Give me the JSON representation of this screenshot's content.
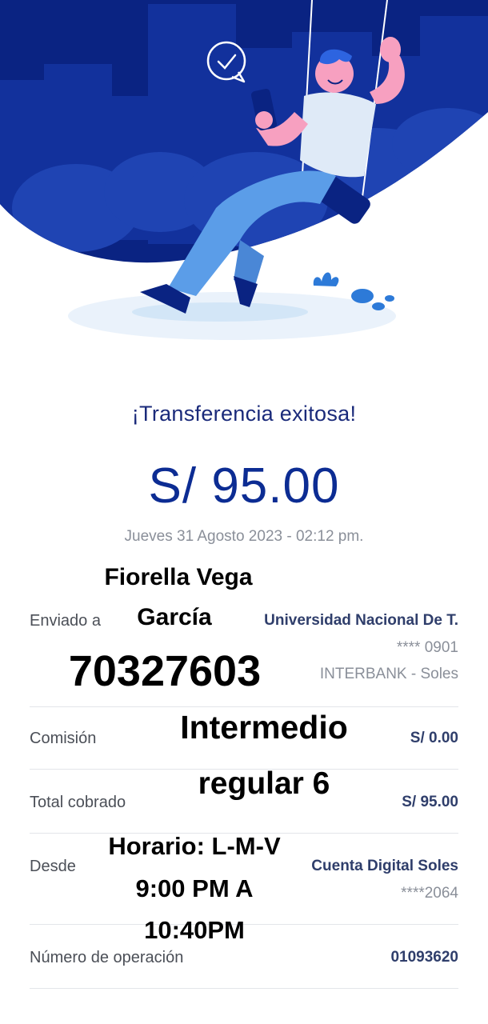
{
  "receipt": {
    "title": "¡Transferencia exitosa!",
    "amount": "S/ 95.00",
    "datetime": "Jueves 31 Agosto 2023 - 02:12 pm."
  },
  "sent_to": {
    "label": "Enviado a",
    "name": "Universidad Nacional De T.",
    "account": "**** 0901",
    "bank": "INTERBANK - Soles"
  },
  "commission": {
    "label": "Comisión",
    "value": "S/ 0.00"
  },
  "total": {
    "label": "Total cobrado",
    "value": "S/ 95.00"
  },
  "from": {
    "label": "Desde",
    "account_name": "Cuenta Digital Soles",
    "account_number": "****2064"
  },
  "operation": {
    "label": "Número de operación",
    "value": "01093620"
  },
  "overlay": {
    "name_line1": "Fiorella Vega",
    "name_line2": "García",
    "number": "70327603",
    "level_line1": "Intermedio",
    "level_line2": "regular 6",
    "schedule_line1": "Horario: L-M-V",
    "schedule_line2": "9:00 PM A",
    "schedule_line3": "10:40PM"
  },
  "colors": {
    "brand_blue": "#0c2c93",
    "hero_dark": "#0a2382",
    "hero_mid": "#1f44b3",
    "text_gray": "#8a8f99"
  },
  "icons": [
    "check-bubble-icon",
    "person-on-swing-illustration",
    "phone-icon"
  ]
}
